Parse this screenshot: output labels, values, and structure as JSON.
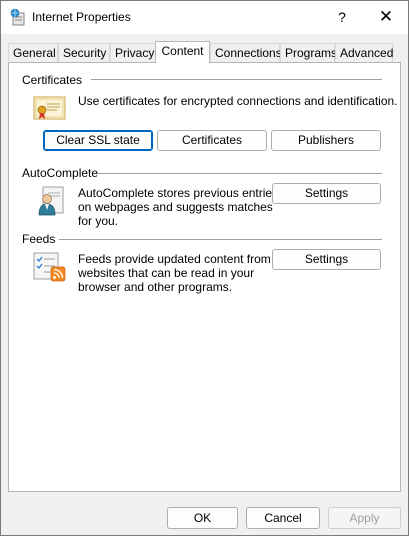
{
  "window": {
    "title": "Internet Properties",
    "help_label": "?",
    "close_label": "✕"
  },
  "tabs": [
    {
      "label": "General"
    },
    {
      "label": "Security"
    },
    {
      "label": "Privacy"
    },
    {
      "label": "Content",
      "active": true
    },
    {
      "label": "Connections"
    },
    {
      "label": "Programs"
    },
    {
      "label": "Advanced"
    }
  ],
  "certificates": {
    "title": "Certificates",
    "description": "Use certificates for encrypted connections and identification.",
    "buttons": {
      "clear_ssl": "Clear SSL state",
      "certificates": "Certificates",
      "publishers": "Publishers"
    }
  },
  "autocomplete": {
    "title": "AutoComplete",
    "description_lines": [
      "AutoComplete stores previous entries",
      "on webpages and suggests matches",
      "for you."
    ],
    "settings_label": "Settings"
  },
  "feeds": {
    "title": "Feeds",
    "description_lines": [
      "Feeds provide updated content from",
      "websites that can be read in your",
      "browser and other programs."
    ],
    "settings_label": "Settings"
  },
  "footer": {
    "ok_label": "OK",
    "cancel_label": "Cancel",
    "apply_label": "Apply"
  },
  "icons": {
    "app": "internet-options-icon",
    "certificate": "certificate-icon",
    "autocomplete": "autocomplete-user-icon",
    "feeds": "feeds-rss-icon"
  },
  "colors": {
    "accent": "#0067c0",
    "rss": "#f5891f"
  }
}
